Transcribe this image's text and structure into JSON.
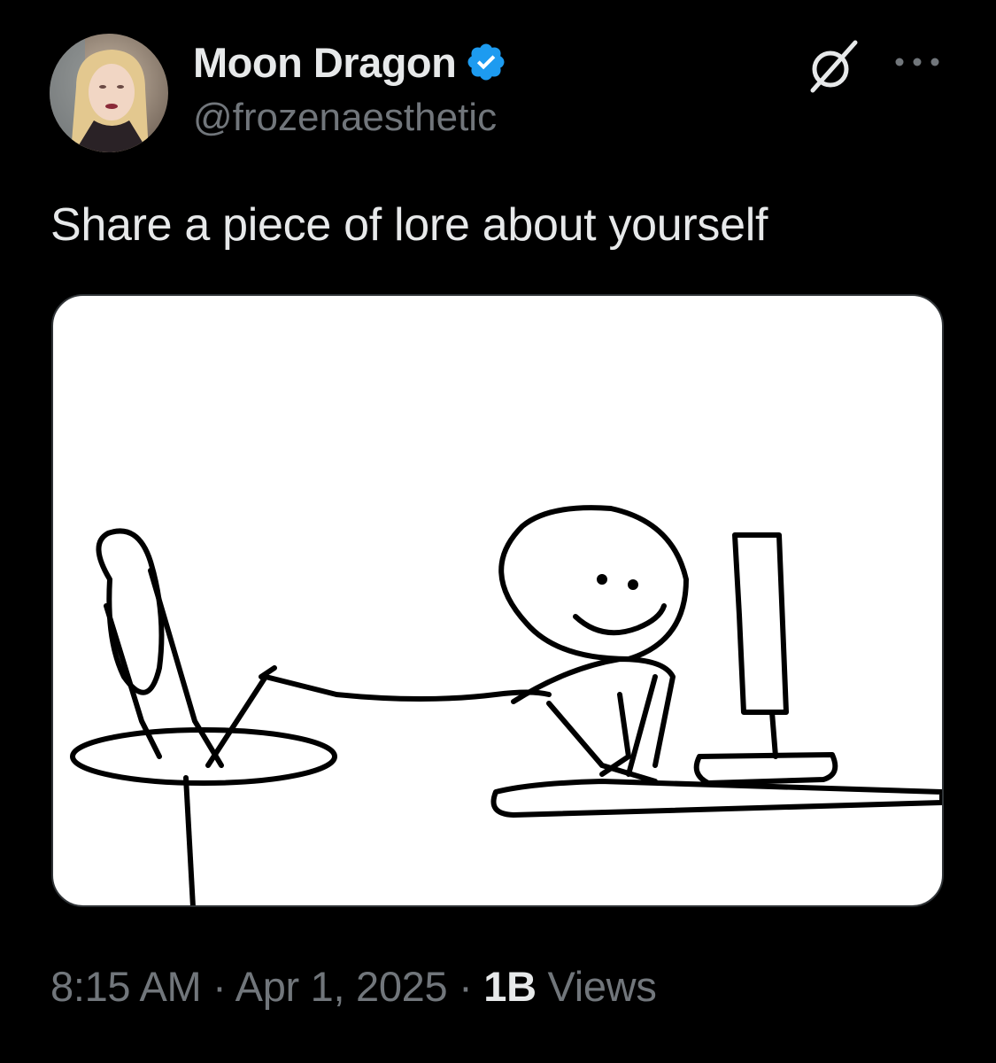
{
  "author": {
    "display_name": "Moon Dragon",
    "handle": "@frozenaesthetic",
    "verified": true,
    "verified_color": "#1d9bf0",
    "avatar_icon": "profile-photo"
  },
  "header_icons": {
    "grok": "grok-icon",
    "more": "more-dots-icon"
  },
  "tweet": {
    "text": "Share a piece of lore about yourself"
  },
  "meta": {
    "time": "8:15 AM",
    "separator": "·",
    "date": "Apr 1, 2025",
    "views_count": "1B",
    "views_label": "Views"
  },
  "colors": {
    "background": "#000000",
    "primary_text": "#e7e9ea",
    "secondary_text": "#71767b",
    "media_border": "#2f3336"
  }
}
